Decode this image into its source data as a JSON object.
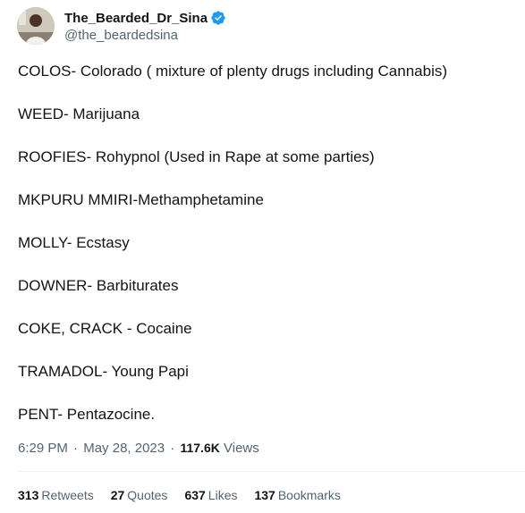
{
  "author": {
    "display_name": "The_Bearded_Dr_Sina",
    "handle": "@the_beardedsina",
    "verified_icon": "verified-badge-icon",
    "verified_color": "#1d9bf0"
  },
  "tweet_lines": [
    "COLOS- Colorado ( mixture of plenty drugs including Cannabis)",
    "WEED- Marijuana",
    "ROOFIES- Rohypnol (Used in Rape at some parties)",
    "MKPURU MMIRI-Methamphetamine",
    "MOLLY- Ecstasy",
    "DOWNER- Barbiturates",
    "COKE, CRACK - Cocaine",
    "TRAMADOL- Young Papi",
    "PENT- Pentazocine."
  ],
  "meta": {
    "time": "6:29 PM",
    "date": "May 28, 2023",
    "separator": "·",
    "views_count": "117.6K",
    "views_label": "Views"
  },
  "stats": {
    "retweets": {
      "count": "313",
      "label": "Retweets"
    },
    "quotes": {
      "count": "27",
      "label": "Quotes"
    },
    "likes": {
      "count": "637",
      "label": "Likes"
    },
    "bookmarks": {
      "count": "137",
      "label": "Bookmarks"
    }
  }
}
